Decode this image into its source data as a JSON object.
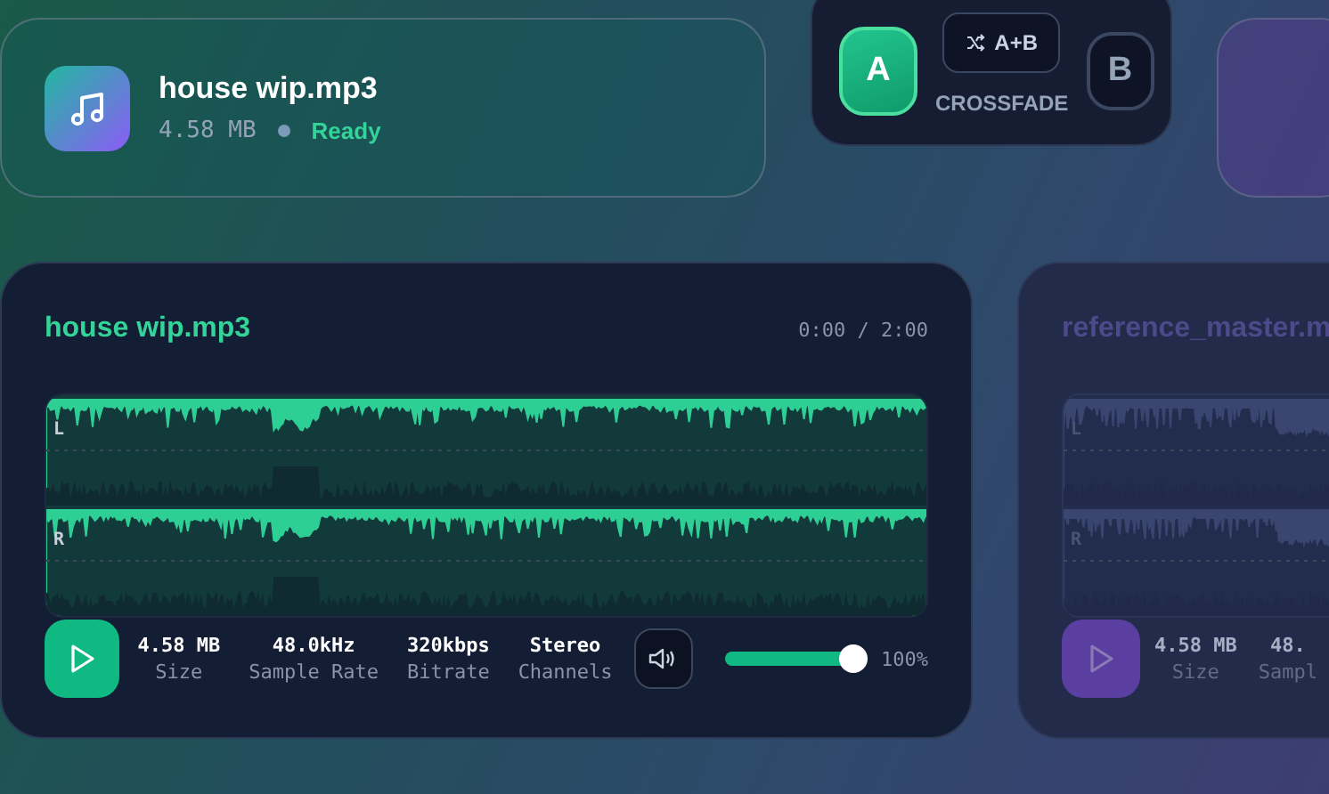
{
  "file_card": {
    "name": "house wip.mp3",
    "size": "4.58 MB",
    "status": "Ready"
  },
  "crossfade": {
    "buttons": [
      {
        "label": "A",
        "kind": "deck",
        "selected": true
      },
      {
        "label": "A+B",
        "kind": "mix",
        "selected": false
      },
      {
        "label": "B",
        "kind": "deck",
        "selected": false
      }
    ],
    "caption": "CROSSFADE"
  },
  "decks": [
    {
      "title": "house wip.mp3",
      "active": true,
      "time": "0:00 / 2:00",
      "channels": [
        "L",
        "R"
      ],
      "stats": [
        {
          "value": "4.58 MB",
          "label": "Size"
        },
        {
          "value": "48.0kHz",
          "label": "Sample Rate"
        },
        {
          "value": "320kbps",
          "label": "Bitrate"
        },
        {
          "value": "Stereo",
          "label": "Channels"
        }
      ],
      "volume": {
        "level": 1.0,
        "reading": "100%"
      }
    },
    {
      "title": "reference_master.m",
      "active": false,
      "channels": [
        "L",
        "R"
      ],
      "stats": [
        {
          "value": "4.58 MB",
          "label": "Size"
        },
        {
          "value": "48.",
          "label": "Sampl"
        }
      ]
    }
  ]
}
